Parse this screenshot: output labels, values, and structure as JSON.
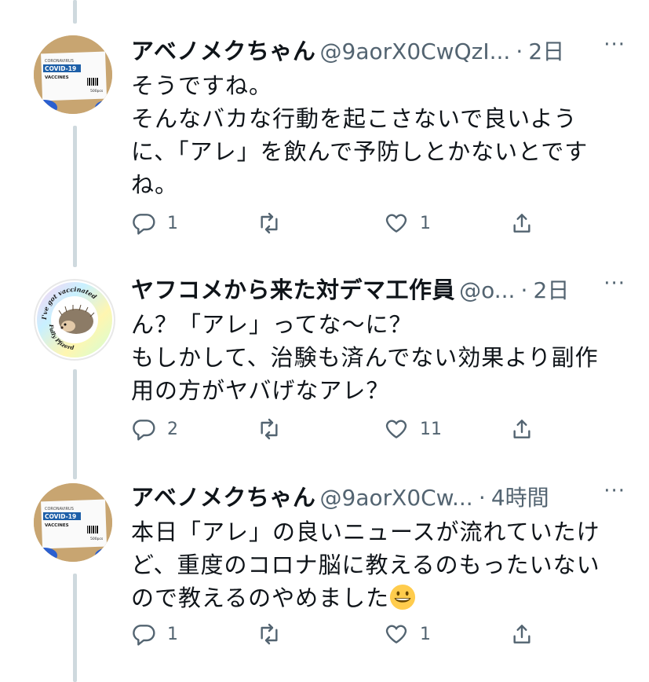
{
  "tweets": [
    {
      "name": "アベノメクちゃん",
      "handle": "@9aorX0CwQzI...",
      "separator": "·",
      "time": "2日",
      "more": "···",
      "lines": [
        "そうですね。",
        "そんなバカな行動を起こさないで良いよう",
        "に、「アレ」を飲んで予防しとかないとです",
        "ね。"
      ],
      "reply_count": "1",
      "retweet_count": "",
      "like_count": "1",
      "avatar": {
        "top_label": "CORONAVIRUS",
        "title": "COVID-19",
        "subtitle": "VACCINES",
        "dose": "500pcs"
      }
    },
    {
      "name": "ヤフコメから来た対デマ工作員",
      "handle": "@o...",
      "separator": "·",
      "time": "2日",
      "more": "···",
      "lines": [
        "ん？「アレ」ってな〜に？",
        "もしかして、治験も済んでない効果より副作",
        "用の方がヤバげなアレ？"
      ],
      "reply_count": "2",
      "retweet_count": "",
      "like_count": "11",
      "avatar": {
        "ring_text_top": "I've got vaccinated",
        "ring_text_bottom": "Fully Pfizerd"
      }
    },
    {
      "name": "アベノメクちゃん",
      "handle": "@9aorX0Cw...",
      "separator": "·",
      "time": "4時間",
      "more": "···",
      "lines": [
        "本日「アレ」の良いニュースが流れていたけ",
        "ど、重度のコロナ脳に教えるのもったいない",
        "ので教えるのやめました"
      ],
      "reply_count": "1",
      "retweet_count": "",
      "like_count": "1",
      "avatar": {
        "top_label": "CORONAVIRUS",
        "title": "COVID-19",
        "subtitle": "VACCINES",
        "dose": "500pcs"
      }
    }
  ],
  "icons": {
    "reply": "reply-icon",
    "retweet": "retweet-icon",
    "like": "like-icon",
    "share": "share-icon",
    "emoji": "grinning-face-icon"
  },
  "colors": {
    "text": "#0f1419",
    "muted": "#536471",
    "thread": "#cfd9de",
    "covid_blue": "#1d5fa8"
  }
}
